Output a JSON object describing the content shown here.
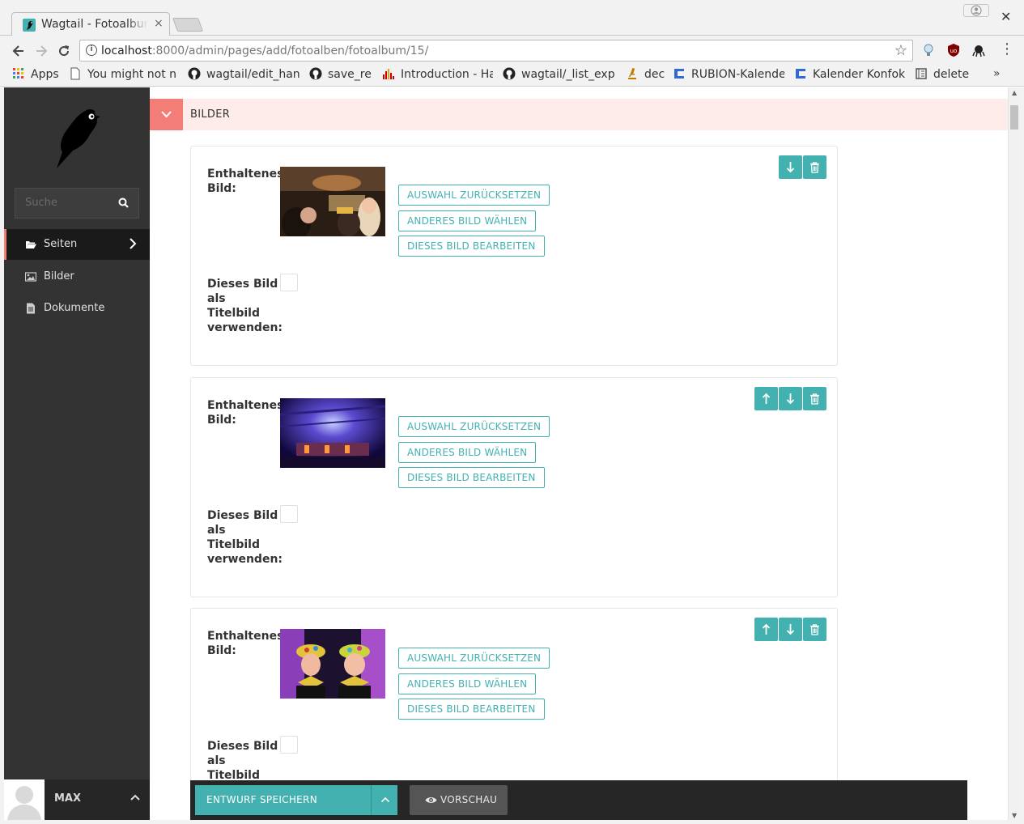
{
  "browser": {
    "tab_title": "Wagtail - Fotoalbum",
    "tab_close": "×",
    "window_close": "✕",
    "url_host": "localhost",
    "url_path": ":8000/admin/pages/add/fotoalben/fotoalbum/15/",
    "bookmarks": [
      {
        "label": "Apps",
        "icon": "apps-grid-icon"
      },
      {
        "label": "You might not ne",
        "icon": "page-icon"
      },
      {
        "label": "wagtail/edit_han",
        "icon": "github-icon"
      },
      {
        "label": "save_re",
        "icon": "github-icon"
      },
      {
        "label": "Introduction - Ha",
        "icon": "chart-icon"
      },
      {
        "label": "wagtail/_list_exp",
        "icon": "github-icon"
      },
      {
        "label": "dec",
        "icon": "microscope-icon"
      },
      {
        "label": "RUBION-Kalende",
        "icon": "calendar-brand-icon"
      },
      {
        "label": "Kalender Konfok",
        "icon": "calendar-brand-icon"
      },
      {
        "label": "delete",
        "icon": "book-icon"
      }
    ],
    "bookmarks_more": "»"
  },
  "sidebar": {
    "search_placeholder": "Suche",
    "items": [
      {
        "label": "Seiten",
        "icon": "folder-open-icon",
        "active": true
      },
      {
        "label": "Bilder",
        "icon": "image-icon",
        "active": false
      },
      {
        "label": "Dokumente",
        "icon": "document-icon",
        "active": false
      }
    ],
    "account_name": "MAX"
  },
  "section": {
    "title": "BILDER"
  },
  "cards": [
    {
      "image_label": "Enthaltenes Bild:",
      "cover_label": "Dieses Bild als Titelbild verwenden:",
      "cover_checked": false,
      "buttons": [
        "AUSWAHL ZURÜCKSETZEN",
        "ANDERES BILD WÄHLEN",
        "DIESES BILD BEARBEITEN"
      ],
      "controls": [
        "move-down-icon",
        "delete-icon"
      ]
    },
    {
      "image_label": "Enthaltenes Bild:",
      "cover_label": "Dieses Bild als Titelbild verwenden:",
      "cover_checked": false,
      "buttons": [
        "AUSWAHL ZURÜCKSETZEN",
        "ANDERES BILD WÄHLEN",
        "DIESES BILD BEARBEITEN"
      ],
      "controls": [
        "move-up-icon",
        "move-down-icon",
        "delete-icon"
      ]
    },
    {
      "image_label": "Enthaltenes Bild:",
      "cover_label": "Dieses Bild als Titelbild verwenden:",
      "cover_checked": false,
      "buttons": [
        "AUSWAHL ZURÜCKSETZEN",
        "ANDERES BILD WÄHLEN",
        "DIESES BILD BEARBEITEN"
      ],
      "controls": [
        "move-up-icon",
        "move-down-icon",
        "delete-icon"
      ]
    }
  ],
  "footer": {
    "save_label": "ENTWURF SPEICHERN",
    "preview_label": "VORSCHAU"
  },
  "colors": {
    "teal": "#43b1b0",
    "salmon": "#f37e77",
    "sidebar_bg": "#333333",
    "header_bg": "#fdecea"
  }
}
